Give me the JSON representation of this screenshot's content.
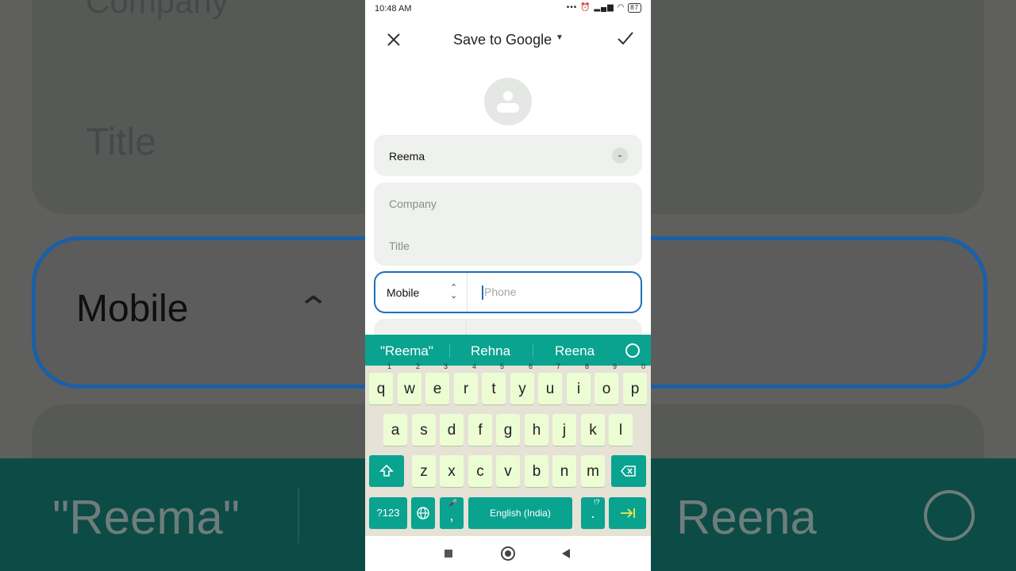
{
  "status_bar": {
    "time": "10:48 AM",
    "battery": "87"
  },
  "app_bar": {
    "title": "Save to Google"
  },
  "contact": {
    "name": "Reema",
    "company_placeholder": "Company",
    "title_placeholder": "Title",
    "phone_type": "Mobile",
    "phone_placeholder": "Phone"
  },
  "keyboard": {
    "suggestions": [
      "\"Reema\"",
      "Rehna",
      "Reena"
    ],
    "row1": [
      {
        "k": "q",
        "n": "1"
      },
      {
        "k": "w",
        "n": "2"
      },
      {
        "k": "e",
        "n": "3"
      },
      {
        "k": "r",
        "n": "4"
      },
      {
        "k": "t",
        "n": "5"
      },
      {
        "k": "y",
        "n": "6"
      },
      {
        "k": "u",
        "n": "7"
      },
      {
        "k": "i",
        "n": "8"
      },
      {
        "k": "o",
        "n": "9"
      },
      {
        "k": "p",
        "n": "0"
      }
    ],
    "row2": [
      "a",
      "s",
      "d",
      "f",
      "g",
      "h",
      "j",
      "k",
      "l"
    ],
    "row3": [
      "z",
      "x",
      "c",
      "v",
      "b",
      "n",
      "m"
    ],
    "symbols_label": "?123",
    "space_label": "English (India)",
    "comma": ",",
    "period": ".",
    "period_hint": "!?"
  },
  "background_zoom": {
    "company": "Company",
    "title": "Title",
    "mobile": "Mobile",
    "suggestion_left": "\"Reema\"",
    "suggestion_right": "Reena"
  },
  "colors": {
    "accent": "#0aa38f",
    "focus": "#1f6fb8",
    "key": "#ecfdd4"
  }
}
